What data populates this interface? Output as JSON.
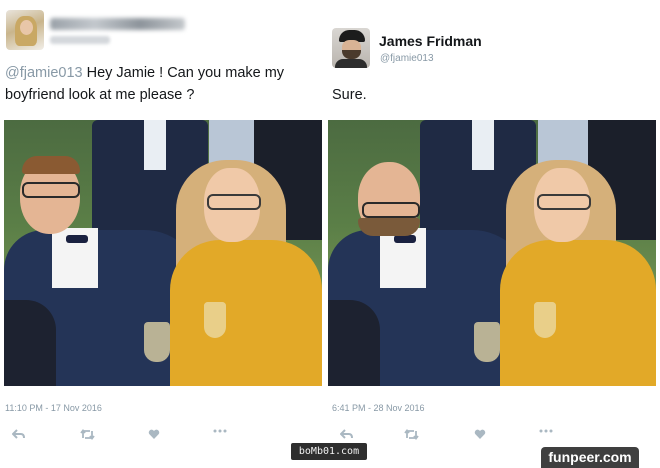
{
  "left_tweet": {
    "mention": "@fjamie013",
    "text": " Hey Jamie ! Can you make my boyfriend look at me please ?",
    "timestamp": "11:10 PM - 17 Nov 2016",
    "photo_alt": "couple photo"
  },
  "right_tweet": {
    "author_name": "James Fridman",
    "author_handle": "@fjamie013",
    "text": "Sure.",
    "timestamp": "6:41 PM - 28 Nov 2016",
    "photo_alt": "edited couple photo"
  },
  "actions": [
    "reply-icon",
    "retweet-icon",
    "like-icon",
    "more-icon"
  ],
  "watermarks": {
    "bomb": "boMb01.com",
    "funpeer": "funpeer.com"
  },
  "colors": {
    "muted": "#8899a6",
    "icon": "#aab8c2",
    "text": "#14171a"
  }
}
